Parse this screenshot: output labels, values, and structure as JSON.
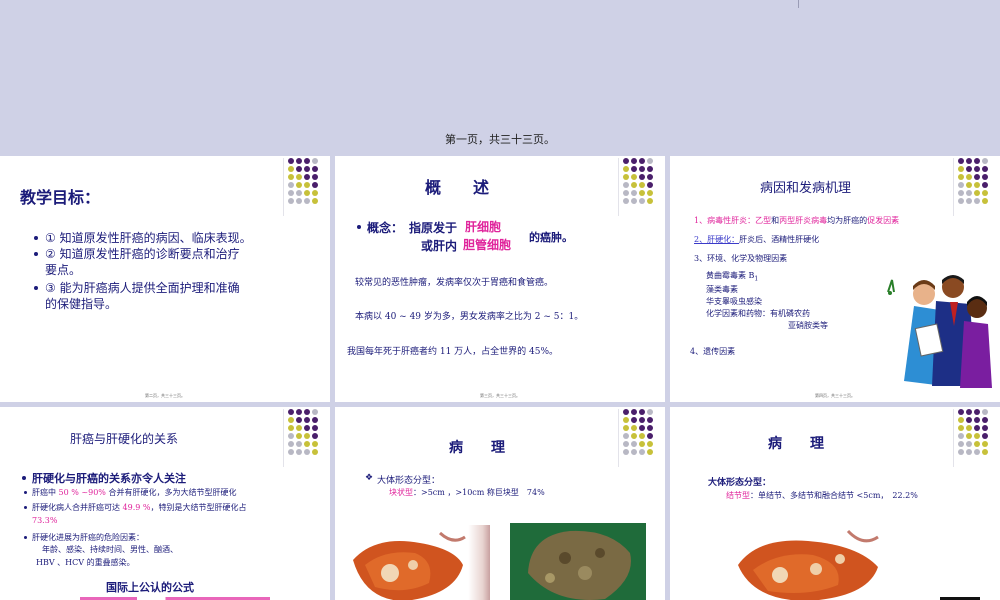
{
  "colors": {
    "background": "#cfd1e6",
    "navy": "#1c1c7a",
    "pink": "#e0259c",
    "blue": "#3b3bc9",
    "purple": "#4a1f6b",
    "olive": "#c7c13a",
    "grey": "#b8b8c4"
  },
  "top": {
    "caption": "第一页，共三十三页。"
  },
  "slide1": {
    "title": "教学目标：",
    "items": [
      "① 知道原发性肝癌的病因、临床表现。",
      "② 知道原发性肝癌的诊断要点和治疗",
      "要点。",
      "③ 能为肝癌病人提供全面护理和准确",
      "的保健指导。"
    ],
    "footer": "第二页，共三十三页。"
  },
  "slide2": {
    "title": "概　　述",
    "concept_label": "概念：",
    "concept_a": "指原发于",
    "concept_b": "肝细胞",
    "concept_c": "或肝内",
    "concept_d": "胆管细胞",
    "concept_e": "的癌肿。",
    "p1": "较常见的恶性肿瘤，发病率仅次于胃癌和食管癌。",
    "p2": "本病以 40 ~ 49 岁为多，男女发病率之比为 2 ~ 5：1。",
    "p3": "我国每年死于肝癌者约 11 万人，占全世界的 45%。",
    "footer": "第三页，共三十三页。"
  },
  "slide3": {
    "title": "病因和发病机理",
    "l1a": "1、病毒性肝炎：",
    "l1b": "乙型",
    "l1c": "和",
    "l1d": "丙型肝炎病毒",
    "l1e": "均为肝癌的",
    "l1f": "促发因素",
    "l2a": "2、肝硬化：",
    "l2b": "肝炎后、酒精性肝硬化",
    "l3": "3、环境、化学及物理因素",
    "l3a": "黄曲霉毒素 B",
    "l3a_sub": "1",
    "l3b": "藻类毒素",
    "l3c": "华支睾吸虫感染",
    "l3d": "化学因素和药物：有机磷农药",
    "l3e": "亚硝胺类等",
    "l4": "4、遗传因素",
    "footer": "第四页，共三十三页。"
  },
  "slide4": {
    "title": "肝癌与肝硬化的关系",
    "h1": "肝硬化与肝癌的关系亦令人关注",
    "b1a": "肝癌中 ",
    "b1b": "50 % ~90%",
    "b1c": " 合并有肝硬化，多为大结节型肝硬化",
    "b2a": "肝硬化病人合并肝癌可达 ",
    "b2b": "49.9 %",
    "b2c": "，特别是大结节型肝硬化占",
    "b2d": "73.3%",
    "b3": "肝硬化进展为肝癌的危险因素：",
    "b3a": "年龄、感染、持续时间、男性、酗酒、",
    "b3b": "HBV 、HCV 的重叠感染。",
    "formula": "国际上公认的公式"
  },
  "slide5": {
    "title": "病　　理",
    "h1": "大体形态分型：",
    "l1a": "块状型",
    "l1b": "：>5cm ，>10cm 称巨块型　74%"
  },
  "slide6": {
    "title": "病　　理",
    "h1": "大体形态分型：",
    "l1a": "结节型",
    "l1b": "：单结节、多结节和融合结节 <5cm，　22.2%"
  }
}
